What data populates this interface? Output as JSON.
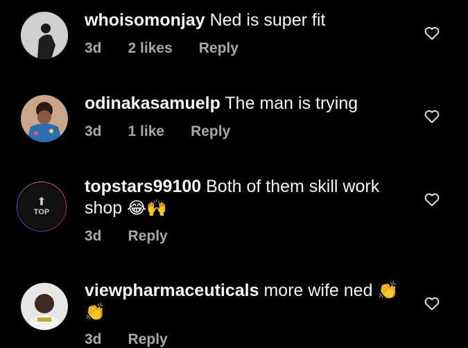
{
  "comments": [
    {
      "username": "whoisomonjay",
      "text": "Ned is super fit",
      "time": "3d",
      "likes": "2 likes",
      "reply": "Reply"
    },
    {
      "username": "odinakasamuelp",
      "text": "The man is trying",
      "time": "3d",
      "likes": "1 like",
      "reply": "Reply"
    },
    {
      "username": "topstars99100",
      "text": "Both of them skill work shop",
      "emoji": "😂🙌",
      "time": "3d",
      "reply": "Reply",
      "avatar_label": "TOP"
    },
    {
      "username": "viewpharmaceuticals",
      "text": "more wife ned",
      "emoji": "👏 👏",
      "time": "3d",
      "reply": "Reply"
    }
  ]
}
